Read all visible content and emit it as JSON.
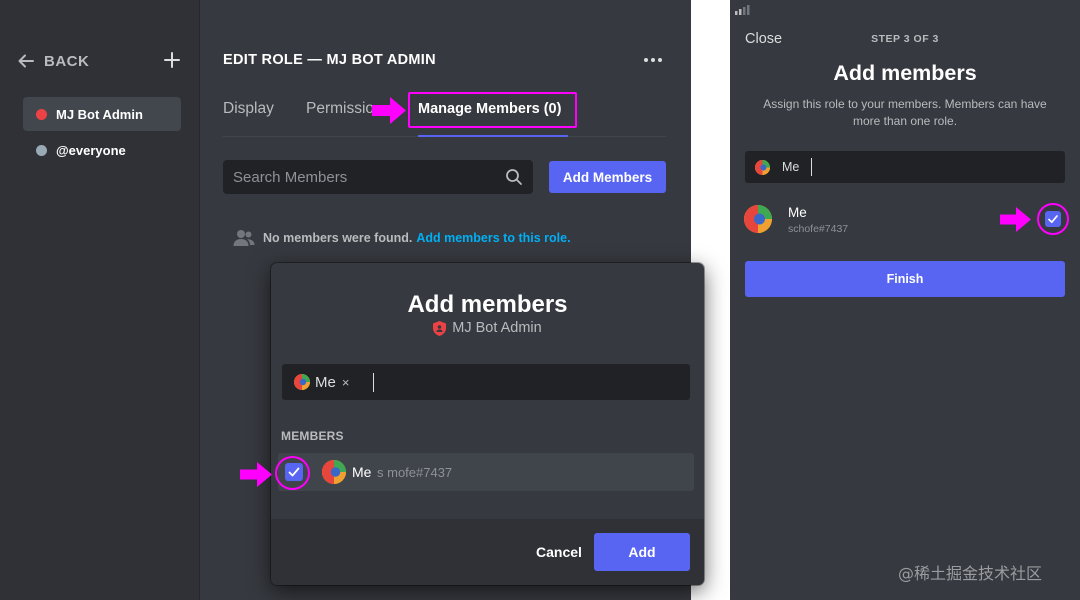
{
  "colors": {
    "blurple": "#5865f2",
    "annotation_magenta": "#ff00ff",
    "link": "#00aff4",
    "role_red": "#ed4245",
    "role_gray": "#99aab5"
  },
  "desktop": {
    "sidebar": {
      "back_label": "BACK",
      "roles": [
        {
          "name": "MJ Bot Admin",
          "active": true
        },
        {
          "name": "@everyone",
          "active": false
        }
      ]
    },
    "header": {
      "title": "EDIT ROLE — MJ BOT ADMIN",
      "more_icon": "ellipsis-icon"
    },
    "tabs": [
      {
        "label": "Display"
      },
      {
        "label": "Permissio"
      },
      {
        "label": "Manage Members (0)",
        "active": true
      }
    ],
    "search": {
      "placeholder": "Search Members",
      "icon": "search-icon"
    },
    "add_members_label": "Add Members",
    "empty_state": {
      "text": "No members were found.",
      "link": "Add members to this role."
    },
    "modal": {
      "title": "Add members",
      "role_name": "MJ Bot Admin",
      "chip_label": "Me",
      "chip_remove": "×",
      "members_heading": "MEMBERS",
      "member": {
        "name": "Me",
        "tag": "s mofe#7437",
        "checked": true
      },
      "cancel_label": "Cancel",
      "add_label": "Add"
    }
  },
  "mobile": {
    "close_label": "Close",
    "step_label": "STEP 3 OF 3",
    "title": "Add members",
    "description": "Assign this role to your members. Members can have more than one role.",
    "chip_label": "Me",
    "member": {
      "name": "Me",
      "tag": "schofe#7437",
      "checked": true
    },
    "finish_label": "Finish"
  },
  "watermark": "@稀土掘金技术社区"
}
